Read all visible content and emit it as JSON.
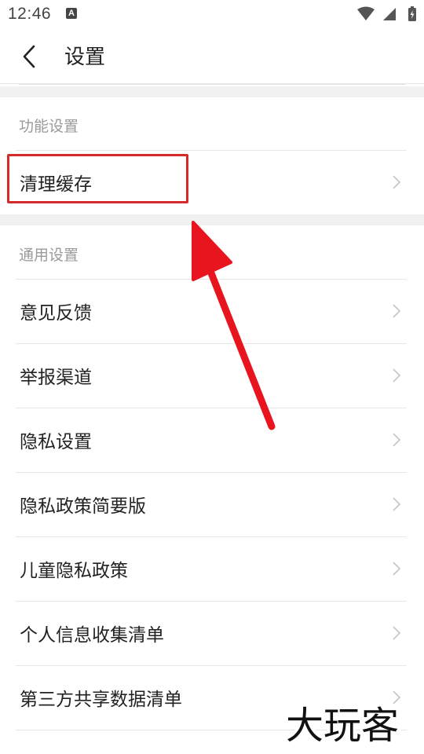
{
  "status_bar": {
    "time": "12:46",
    "notification_icon": "A"
  },
  "header": {
    "title": "设置"
  },
  "sections": [
    {
      "title": "功能设置",
      "items": [
        {
          "label": "清理缓存"
        }
      ]
    },
    {
      "title": "通用设置",
      "items": [
        {
          "label": "意见反馈"
        },
        {
          "label": "举报渠道"
        },
        {
          "label": "隐私设置"
        },
        {
          "label": "隐私政策简要版"
        },
        {
          "label": "儿童隐私政策"
        },
        {
          "label": "个人信息收集清单"
        },
        {
          "label": "第三方共享数据清单"
        }
      ]
    }
  ],
  "watermark": {
    "text": "大玩客"
  },
  "colors": {
    "highlight": "#d52a2a",
    "arrow": "#e8141e",
    "section_gap": "#f1f1f1"
  },
  "icons": [
    "back-arrow-icon",
    "wifi-icon",
    "signal-icon",
    "battery-icon",
    "chevron-right-icon"
  ]
}
